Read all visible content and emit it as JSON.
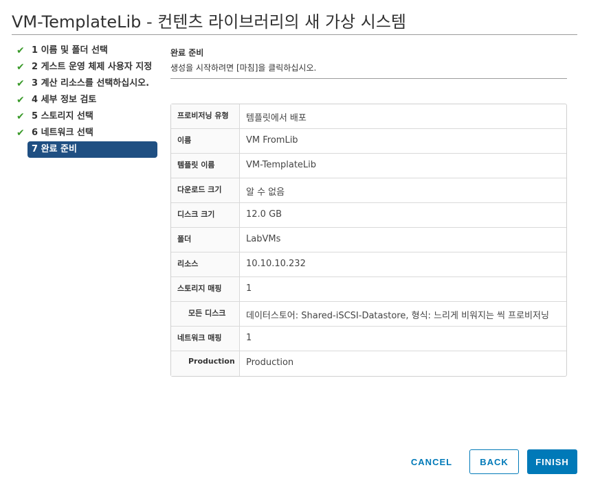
{
  "window": {
    "title": "VM-TemplateLib - 컨텐츠 라이브러리의 새 가상 시스템"
  },
  "steps": [
    {
      "label": "1 이름 및 폴더 선택",
      "done": true
    },
    {
      "label": "2 게스트 운영 체제 사용자 지정",
      "done": true
    },
    {
      "label": "3 계산 리소스를 선택하십시오.",
      "done": true
    },
    {
      "label": "4 세부 정보 검토",
      "done": true
    },
    {
      "label": "5 스토리지 선택",
      "done": true
    },
    {
      "label": "6 네트워크 선택",
      "done": true
    },
    {
      "label": "7 완료 준비",
      "done": false,
      "active": true
    }
  ],
  "panel": {
    "title": "완료 준비",
    "description": "생성을 시작하려면 [마침]을 클릭하십시오."
  },
  "summary": [
    {
      "key": "프로비저닝 유형",
      "value": "템플릿에서 배포"
    },
    {
      "key": "이름",
      "value": "VM FromLib"
    },
    {
      "key": "템플릿 이름",
      "value": "VM-TemplateLib"
    },
    {
      "key": "다운로드 크기",
      "value": "알 수 없음"
    },
    {
      "key": "디스크 크기",
      "value": "12.0 GB"
    },
    {
      "key": "폴더",
      "value": "LabVMs"
    },
    {
      "key": "리소스",
      "value": "10.10.10.232"
    },
    {
      "key": "스토리지 매핑",
      "value": "1"
    },
    {
      "key": "모든 디스크",
      "value": "데이터스토어: Shared-iSCSI-Datastore, 형식: 느리게 비워지는 씩 프로비저닝"
    },
    {
      "key": "네트워크 매핑",
      "value": "1"
    },
    {
      "key": "Production",
      "value": "Production"
    }
  ],
  "footer": {
    "cancel_label": "CANCEL",
    "back_label": "BACK",
    "finish_label": "FINISH"
  },
  "colors": {
    "accent": "#0079b8",
    "active_step": "#1f4f82",
    "check": "#3a9a2a"
  },
  "icons": {
    "step_done": "check-icon"
  }
}
